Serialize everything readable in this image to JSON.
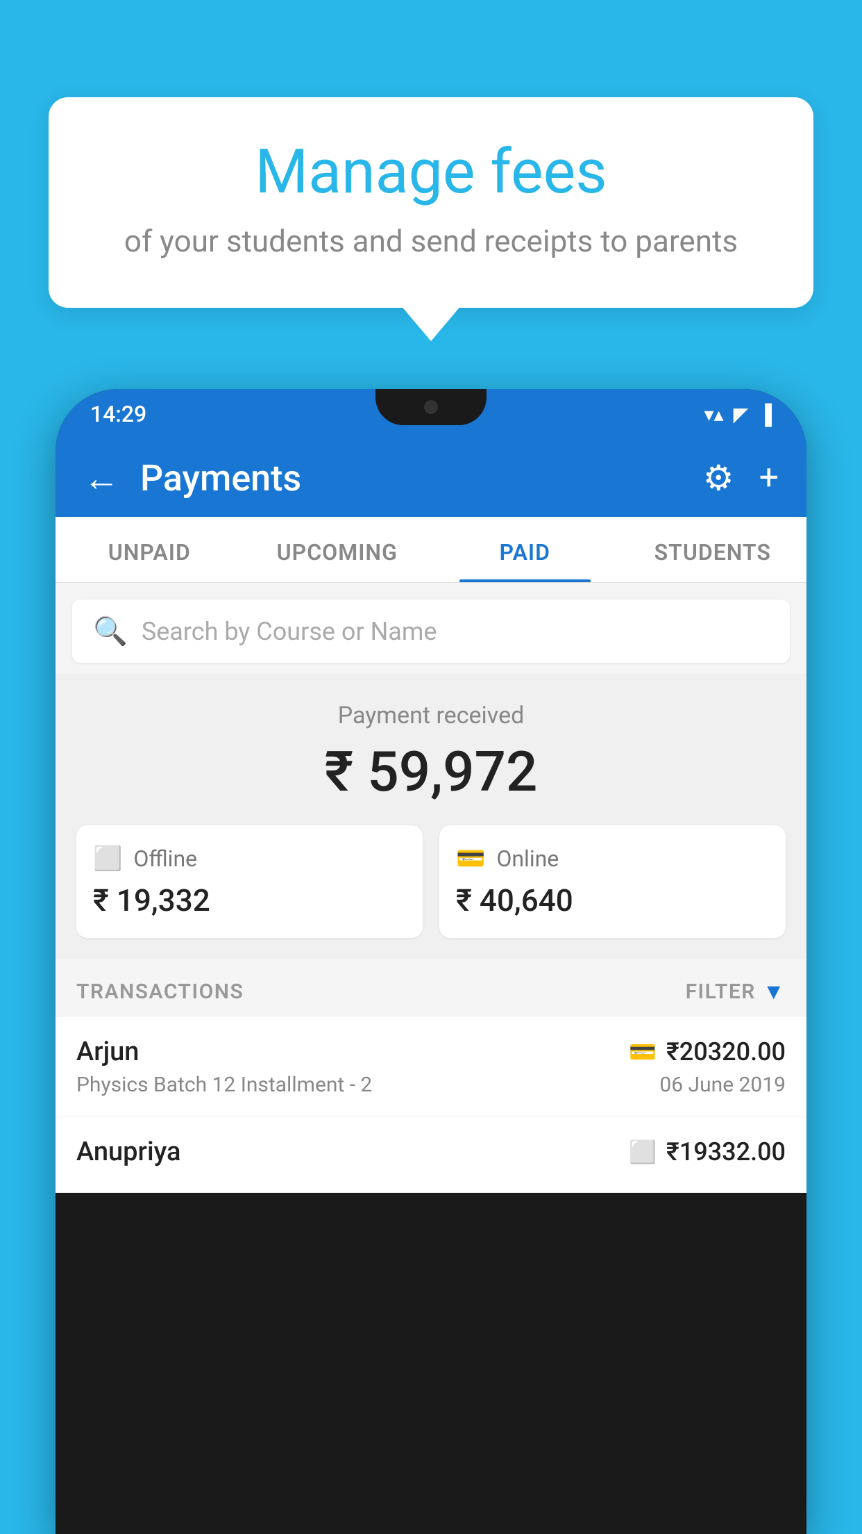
{
  "background_color": "#29b6e8",
  "bubble": {
    "title": "Manage fees",
    "subtitle": "of your students and send receipts to parents"
  },
  "phone": {
    "status_bar": {
      "time": "14:29",
      "wifi_icon": "▲",
      "signal_icon": "▲",
      "battery_icon": "▪"
    },
    "app_bar": {
      "title": "Payments",
      "back_label": "←",
      "gear_label": "⚙",
      "plus_label": "+"
    },
    "tabs": [
      {
        "label": "UNPAID",
        "active": false
      },
      {
        "label": "UPCOMING",
        "active": false
      },
      {
        "label": "PAID",
        "active": true
      },
      {
        "label": "STUDENTS",
        "active": false
      }
    ],
    "search": {
      "placeholder": "Search by Course or Name"
    },
    "payment_summary": {
      "label": "Payment received",
      "amount": "₹ 59,972",
      "offline_label": "Offline",
      "offline_amount": "₹ 19,332",
      "online_label": "Online",
      "online_amount": "₹ 40,640"
    },
    "transactions": {
      "header_label": "TRANSACTIONS",
      "filter_label": "FILTER",
      "items": [
        {
          "name": "Arjun",
          "description": "Physics Batch 12 Installment - 2",
          "amount": "₹20320.00",
          "date": "06 June 2019",
          "payment_type": "online"
        },
        {
          "name": "Anupriya",
          "description": "",
          "amount": "₹19332.00",
          "date": "",
          "payment_type": "offline"
        }
      ]
    }
  }
}
